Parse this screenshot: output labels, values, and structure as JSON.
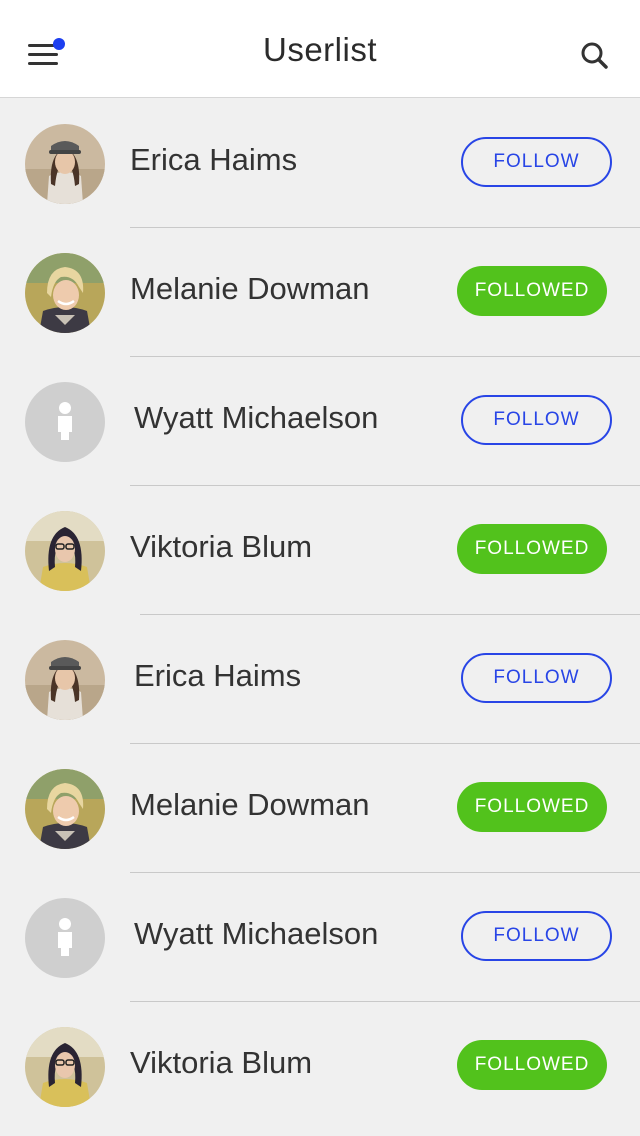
{
  "header": {
    "title": "Userlist",
    "menu_icon": "hamburger-menu-icon",
    "notification_dot_color": "#1d3ff0",
    "search_icon": "search-icon"
  },
  "colors": {
    "follow_outline": "#2845e6",
    "followed_fill": "#52c21c",
    "background": "#f0f0f0"
  },
  "users": [
    {
      "name": "Erica Haims",
      "status": "follow",
      "button_label": "FOLLOW",
      "avatar": "photo"
    },
    {
      "name": "Melanie Dowman",
      "status": "followed",
      "button_label": "FOLLOWED",
      "avatar": "photo"
    },
    {
      "name": "Wyatt Michaelson",
      "status": "follow",
      "button_label": "FOLLOW",
      "avatar": "placeholder"
    },
    {
      "name": "Viktoria Blum",
      "status": "followed",
      "button_label": "FOLLOWED",
      "avatar": "photo"
    },
    {
      "name": "Erica Haims",
      "status": "follow",
      "button_label": "FOLLOW",
      "avatar": "photo"
    },
    {
      "name": "Melanie Dowman",
      "status": "followed",
      "button_label": "FOLLOWED",
      "avatar": "photo"
    },
    {
      "name": "Wyatt Michaelson",
      "status": "follow",
      "button_label": "FOLLOW",
      "avatar": "placeholder"
    },
    {
      "name": "Viktoria Blum",
      "status": "followed",
      "button_label": "FOLLOWED",
      "avatar": "photo"
    }
  ]
}
